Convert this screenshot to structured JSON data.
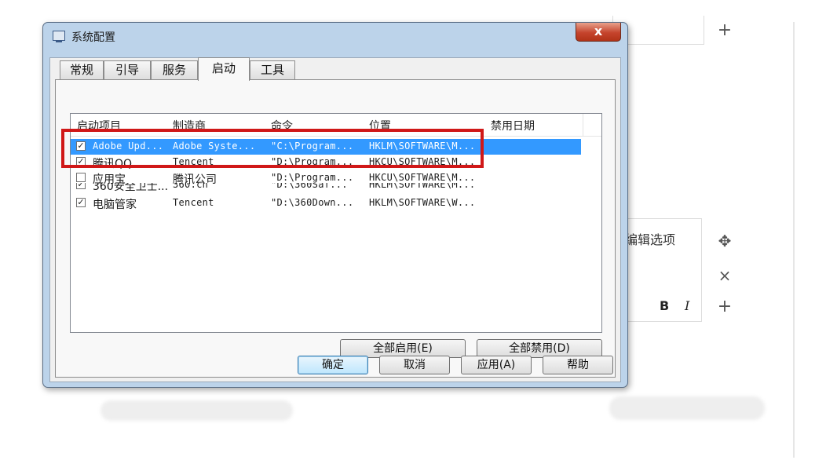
{
  "dialog": {
    "title": "系统配置",
    "close_glyph": "x",
    "tabs": [
      "常规",
      "引导",
      "服务",
      "启动",
      "工具"
    ],
    "active_tab": "启动",
    "columns": [
      "启动项目",
      "制造商",
      "命令",
      "位置",
      "禁用日期"
    ],
    "rows": [
      {
        "checked": true,
        "item": "Adobe Upd...",
        "maker": "Adobe Syste...",
        "command": "\"C:\\Program...",
        "location": "HKLM\\SOFTWARE\\M...",
        "selected": true
      },
      {
        "checked": true,
        "item": "腾讯QQ",
        "maker": "Tencent",
        "command": "\"D:\\Program...",
        "location": "HKCU\\SOFTWARE\\M...",
        "selected": false
      },
      {
        "checked": false,
        "item": "应用宝",
        "maker": "腾讯公司",
        "command": "\"D:\\Program...",
        "location": "HKCU\\SOFTWARE\\M...",
        "selected": false
      },
      {
        "checked": true,
        "item": "360安全卫士...",
        "maker": "360.cn",
        "command": "\"D:\\360Saf...",
        "location": "HKLM\\SOFTWARE\\M...",
        "selected": false
      },
      {
        "checked": true,
        "item": "电脑管家",
        "maker": "Tencent",
        "command": "\"D:\\360Down...",
        "location": "HKLM\\SOFTWARE\\W...",
        "selected": false
      }
    ],
    "enable_all": "全部启用(E)",
    "disable_all": "全部禁用(D)",
    "ok": "确定",
    "cancel": "取消",
    "apply": "应用(A)",
    "help": "帮助"
  },
  "editor": {
    "option_text": "编辑选项",
    "bold": "B",
    "italic": "I",
    "add_glyph": "+",
    "move_glyph": "✥",
    "close_glyph": "×"
  },
  "colors": {
    "selection": "#3399ff",
    "highlight_border": "#d01818",
    "dialog_frame": "#bcd3ea"
  }
}
